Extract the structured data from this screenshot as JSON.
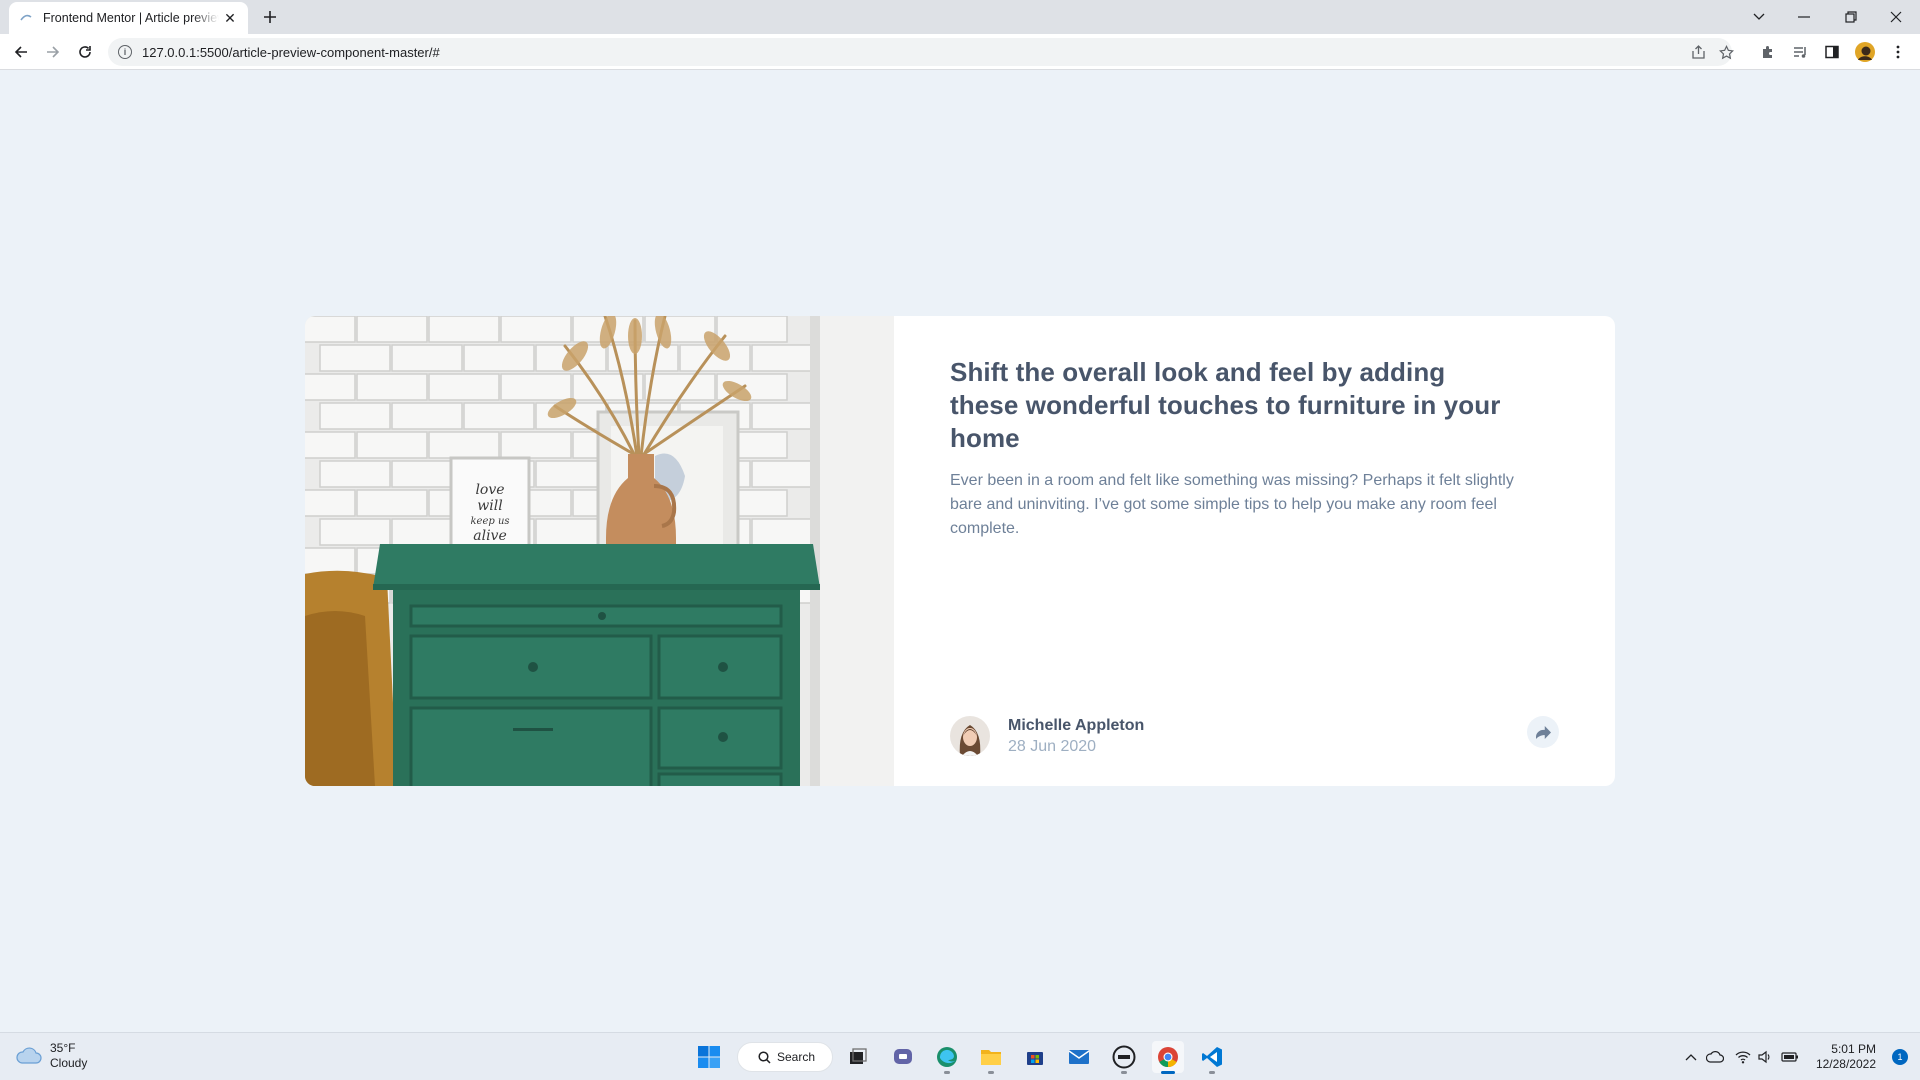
{
  "browser": {
    "tab_title": "Frontend Mentor | Article preview component",
    "url": "127.0.0.1:5500/article-preview-component-master/#"
  },
  "article": {
    "title": "Shift the overall look and feel by adding these wonderful touches to furniture in your home",
    "summary": "Ever been in a room and felt like something was missing? Perhaps it felt slightly bare and uninviting. I’ve got some simple tips to help you make any room feel complete.",
    "author_name": "Michelle Appleton",
    "date": "28 Jun 2020",
    "frame_text": [
      "love",
      "will",
      "keep us",
      "alive"
    ]
  },
  "taskbar": {
    "temperature": "35°F",
    "weather": "Cloudy",
    "search_label": "Search",
    "time": "5:01 PM",
    "date": "12/28/2022",
    "notification_count": "1"
  },
  "colors": {
    "page_bg": "#ecf2f8",
    "title": "#48556a",
    "body_text": "#6e8098",
    "muted": "#9eafc2",
    "dresser_green": "#2f7b63"
  }
}
